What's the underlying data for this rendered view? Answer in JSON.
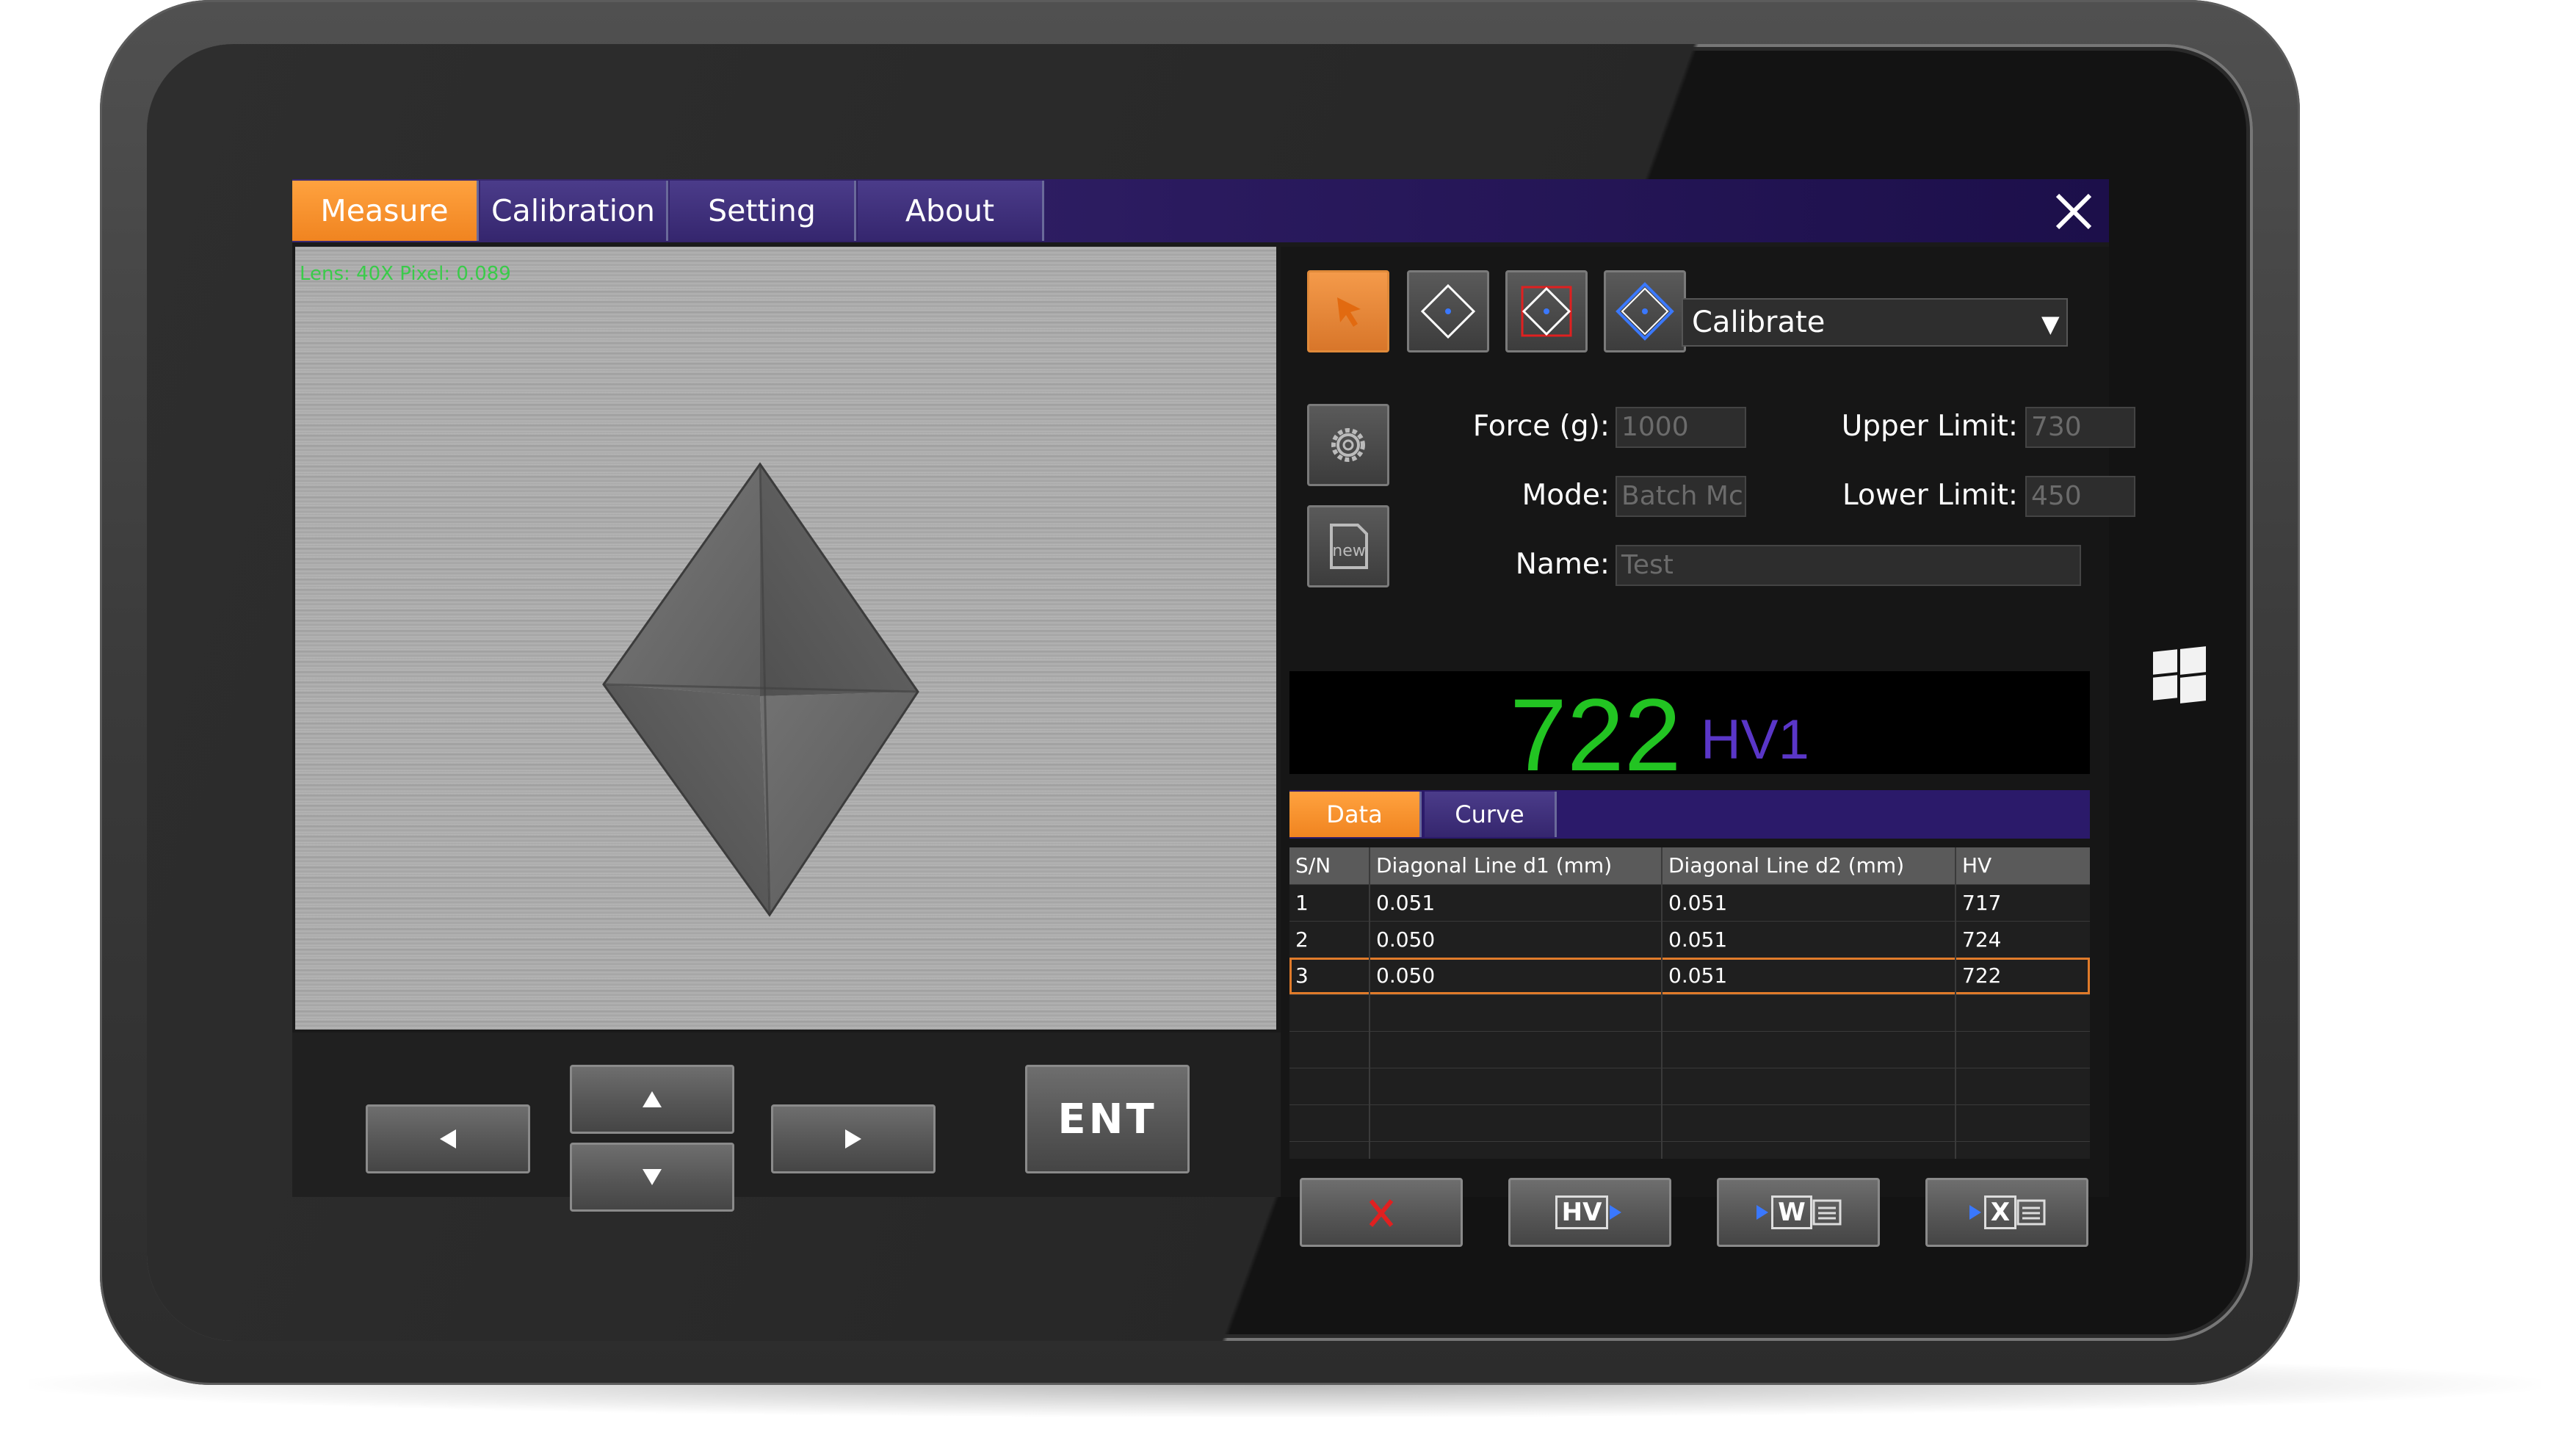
{
  "tabs": [
    {
      "label": "Measure",
      "active": true
    },
    {
      "label": "Calibration",
      "active": false
    },
    {
      "label": "Setting",
      "active": false
    },
    {
      "label": "About",
      "active": false
    }
  ],
  "camera": {
    "overlay_text": "Lens: 40X  Pixel: 0.089"
  },
  "nav": {
    "ent_label": "ENT"
  },
  "toolbar": {
    "mode_select": "Calibrate"
  },
  "params": {
    "force_label": "Force (g):",
    "force_value": "1000",
    "mode_label": "Mode:",
    "mode_value": "Batch Mc",
    "upper_label": "Upper Limit:",
    "upper_value": "730",
    "lower_label": "Lower Limit:",
    "lower_value": "450",
    "name_label": "Name:",
    "name_value": "Test"
  },
  "result": {
    "value": "722",
    "unit": "HV1"
  },
  "subtabs": [
    {
      "label": "Data",
      "active": true
    },
    {
      "label": "Curve",
      "active": false
    }
  ],
  "table": {
    "columns": [
      "S/N",
      "Diagonal Line d1 (mm)",
      "Diagonal Line d2 (mm)",
      "HV"
    ],
    "rows": [
      [
        "1",
        "0.051",
        "0.051",
        "717"
      ],
      [
        "2",
        "0.050",
        "0.051",
        "724"
      ],
      [
        "3",
        "0.050",
        "0.051",
        "722"
      ]
    ],
    "selected_row": 3
  },
  "actions": {
    "hv_label": "HV",
    "w_label": "W",
    "x_label": "X"
  },
  "colors": {
    "accent_orange": "#f08420",
    "purple": "#2a1a5e",
    "result_green": "#22c422",
    "unit_purple": "#5a36c8"
  }
}
